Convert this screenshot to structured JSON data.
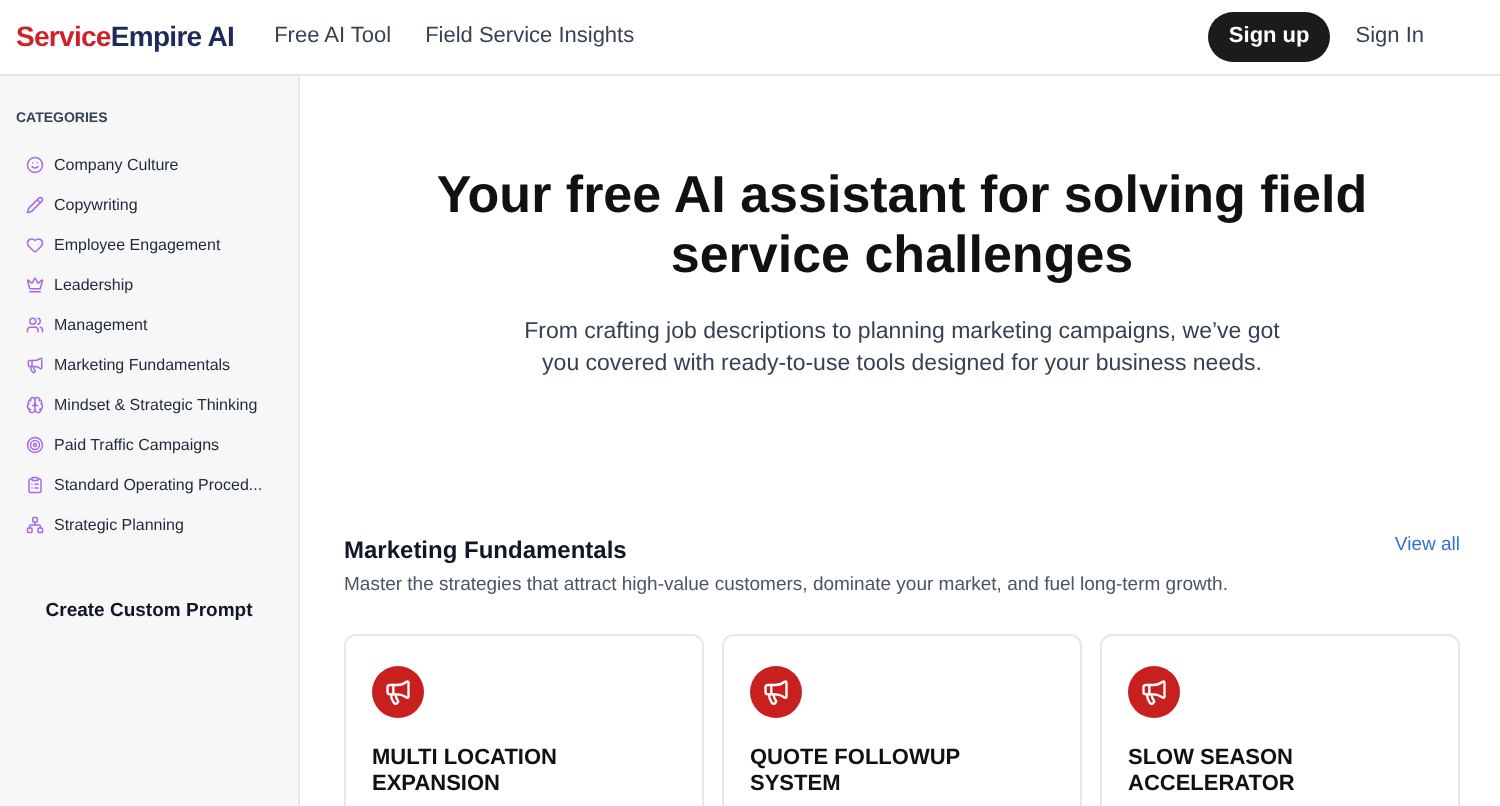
{
  "header": {
    "logo": {
      "part_1": "Service",
      "part_2": "Empire AI"
    },
    "nav": [
      "Free AI Tool",
      "Field Service Insights"
    ],
    "sign_up": "Sign up",
    "sign_in": "Sign In"
  },
  "sidebar": {
    "heading": "CATEGORIES",
    "items": [
      {
        "label": "Company Culture",
        "selected": false
      },
      {
        "label": "Copywriting",
        "selected": false
      },
      {
        "label": "Employee Engagement",
        "selected": false
      },
      {
        "label": "Leadership",
        "selected": false
      },
      {
        "label": "Management",
        "selected": false
      },
      {
        "label": "Marketing Fundamentals",
        "selected": false
      },
      {
        "label": "Mindset & Strategic Thinking",
        "selected": false
      },
      {
        "label": "Paid Traffic Campaigns",
        "selected": false
      },
      {
        "label": "Standard Operating Proced...",
        "selected": false
      },
      {
        "label": "Strategic Planning",
        "selected": false
      }
    ],
    "create_button": "Create Custom Prompt"
  },
  "hero": {
    "title": "Your free AI assistant for solving field service challenges",
    "subtitle": "From crafting job descriptions to planning marketing campaigns, we’ve got you covered with ready-to-use tools designed for your business needs."
  },
  "section": {
    "title": "Marketing Fundamentals",
    "view_all": "View all",
    "description": "Master the strategies that attract high-value customers, dominate your market, and fuel long-term growth.",
    "cards": [
      {
        "title": "MULTI LOCATION EXPANSION"
      },
      {
        "title": "QUOTE FOLLOWUP SYSTEM"
      },
      {
        "title": "SLOW SEASON ACCELERATOR"
      }
    ]
  }
}
